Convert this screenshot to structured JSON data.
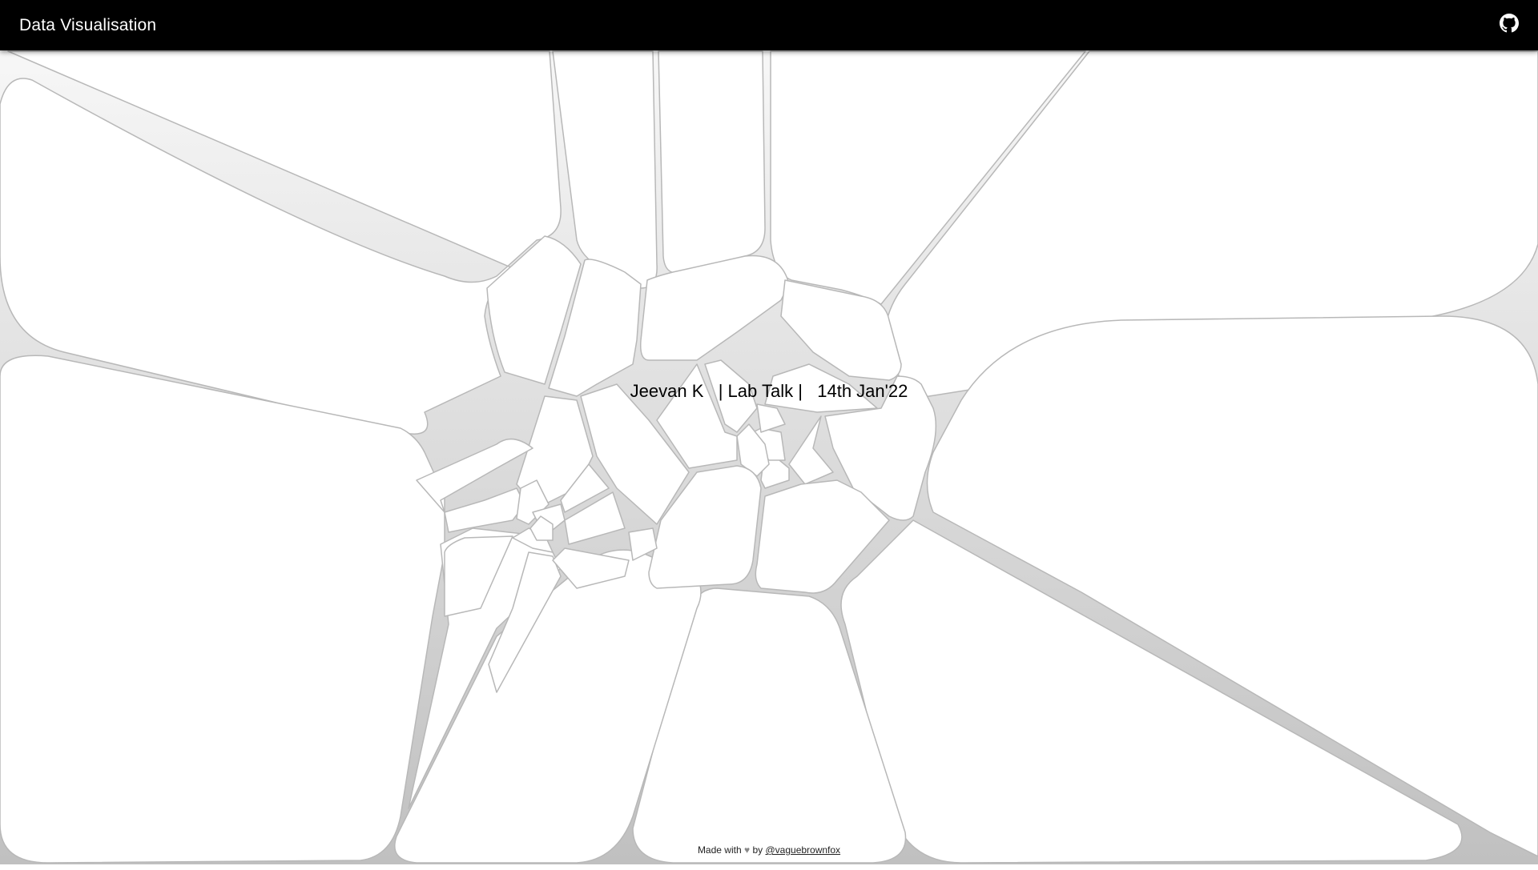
{
  "header": {
    "title": "Data Visualisation",
    "github_icon": "github-icon"
  },
  "main": {
    "tagline": "Jeevan K   | Lab Talk |   14th Jan'22"
  },
  "footer": {
    "made_with": "Made with",
    "heart": "♥",
    "by": "by",
    "author_link": "@vaguebrownfox"
  },
  "colors": {
    "header_bg": "#000000",
    "header_text": "#ffffff",
    "cell_fill": "#ffffff",
    "cell_stroke": "#b8b8b8",
    "gap_light": "#f2f2f2",
    "gap_dark": "#c4c4c4"
  }
}
